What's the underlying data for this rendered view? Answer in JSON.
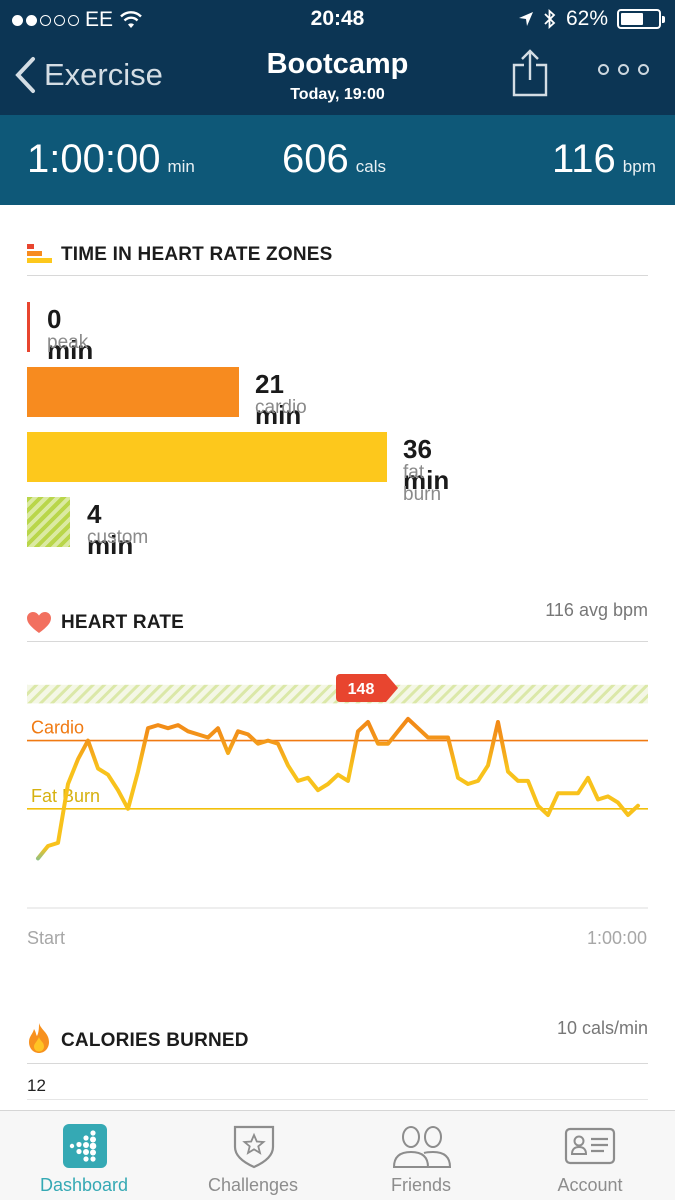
{
  "status_bar": {
    "carrier": "EE",
    "time": "20:48",
    "battery": "62%",
    "battery_level": 0.62
  },
  "nav": {
    "back_label": "Exercise",
    "title": "Bootcamp",
    "subtitle": "Today, 19:00"
  },
  "summary": {
    "duration": "1:00:00",
    "duration_unit": "min",
    "calories": "606",
    "calories_unit": "cals",
    "heart_rate": "116",
    "heart_rate_unit": "bpm"
  },
  "zones": {
    "title": "TIME IN HEART RATE ZONES",
    "items": [
      {
        "value": "0 min",
        "label": "peak",
        "minutes": 0,
        "color": "#e8452f"
      },
      {
        "value": "21 min",
        "label": "cardio",
        "minutes": 21,
        "color": "#f78b1f"
      },
      {
        "value": "36 min",
        "label": "fat burn",
        "minutes": 36,
        "color": "#fdc81c"
      },
      {
        "value": "4 min",
        "label": "custom",
        "minutes": 4,
        "color": "#b9d64a"
      }
    ]
  },
  "heart_rate": {
    "title": "HEART RATE",
    "avg": "116 avg bpm",
    "peak_badge": "148",
    "cardio_label": "Cardio",
    "fatburn_label": "Fat Burn",
    "start_label": "Start",
    "end_label": "1:00:00"
  },
  "calories": {
    "title": "CALORIES BURNED",
    "rate": "10 cals/min",
    "axis_top": "12"
  },
  "tabs": [
    {
      "label": "Dashboard",
      "active": true
    },
    {
      "label": "Challenges",
      "active": false
    },
    {
      "label": "Friends",
      "active": false
    },
    {
      "label": "Account",
      "active": false
    }
  ],
  "chart_data": {
    "type": "line",
    "title": "HEART RATE",
    "xlabel": "",
    "ylabel": "",
    "x_range": [
      "Start",
      "1:00:00"
    ],
    "ylim": [
      80,
      160
    ],
    "thresholds": [
      {
        "name": "Cardio",
        "value": 134,
        "color": "#f07a12"
      },
      {
        "name": "Fat Burn",
        "value": 112,
        "color": "#f2c00c"
      }
    ],
    "custom_zone": [
      146,
      152
    ],
    "peak": {
      "minute": 33,
      "bpm": 148
    },
    "series": [
      {
        "x_minutes": [
          0,
          1,
          2,
          3,
          4,
          5,
          6,
          7,
          8,
          9,
          10,
          11,
          12,
          13,
          14,
          15,
          16,
          17,
          18,
          19,
          20,
          21,
          22,
          23,
          24,
          25,
          26,
          27,
          28,
          29,
          30,
          31,
          32,
          33,
          34,
          35,
          36,
          37,
          38,
          39,
          40,
          41,
          42,
          43,
          44,
          45,
          46,
          47,
          48,
          49,
          50,
          51,
          52,
          53,
          54,
          55,
          56,
          57,
          58,
          59,
          60
        ],
        "bpm": [
          96,
          100,
          101,
          120,
          128,
          134,
          125,
          123,
          118,
          112,
          124,
          138,
          139,
          138,
          139,
          137,
          136,
          135,
          138,
          130,
          137,
          136,
          133,
          134,
          133,
          126,
          121,
          122,
          118,
          120,
          123,
          121,
          137,
          140,
          133,
          133,
          137,
          141,
          138,
          135,
          135,
          135,
          122,
          120,
          121,
          126,
          140,
          124,
          121,
          121,
          113,
          110,
          117,
          117,
          117,
          122,
          115,
          116,
          114,
          110,
          113
        ]
      }
    ]
  }
}
